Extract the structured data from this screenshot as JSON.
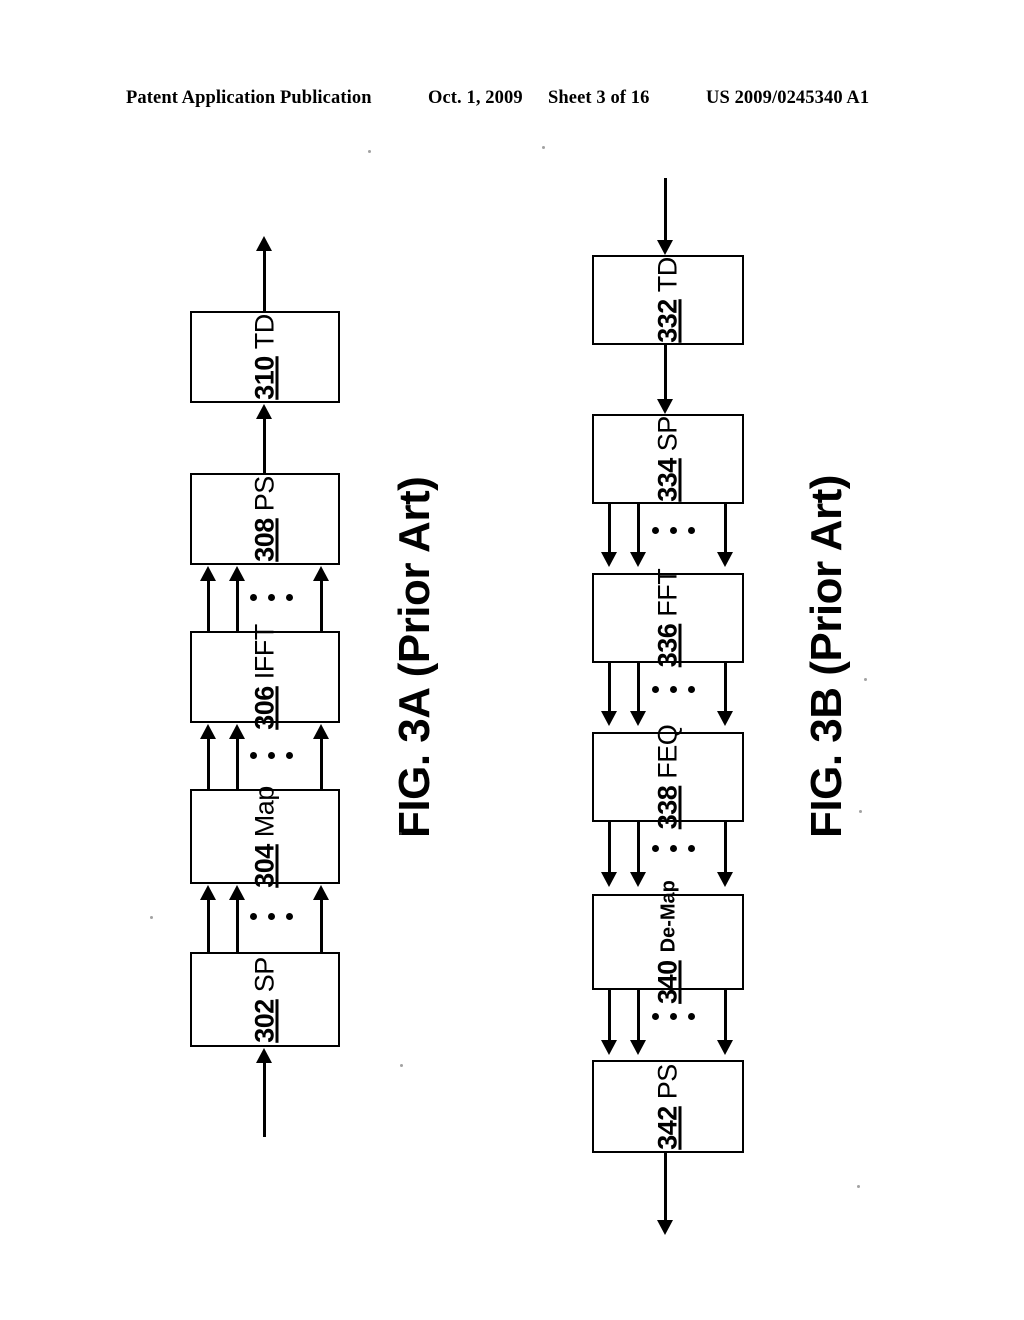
{
  "header": {
    "publication": "Patent Application Publication",
    "date": "Oct. 1, 2009",
    "sheet": "Sheet 3 of 16",
    "document_number": "US 2009/0245340 A1"
  },
  "figures": [
    {
      "id": "3A",
      "caption": "FIG. 3A (Prior Art)",
      "flow_direction": "upward",
      "blocks": [
        {
          "ref": "302",
          "name": "SP"
        },
        {
          "ref": "304",
          "name": "Map"
        },
        {
          "ref": "306",
          "name": "IFFT"
        },
        {
          "ref": "308",
          "name": "PS"
        },
        {
          "ref": "310",
          "name": "TD"
        }
      ],
      "bus_ellipsis": "• • •"
    },
    {
      "id": "3B",
      "caption": "FIG. 3B (Prior Art)",
      "flow_direction": "downward",
      "blocks": [
        {
          "ref": "332",
          "name": "TD"
        },
        {
          "ref": "334",
          "name": "SP"
        },
        {
          "ref": "336",
          "name": "FFT"
        },
        {
          "ref": "338",
          "name": "FEQ"
        },
        {
          "ref": "340",
          "name": "De-Map"
        },
        {
          "ref": "342",
          "name": "PS"
        }
      ],
      "bus_ellipsis": "• • •"
    }
  ],
  "colors": {
    "ink": "#000000",
    "paper": "#ffffff"
  }
}
